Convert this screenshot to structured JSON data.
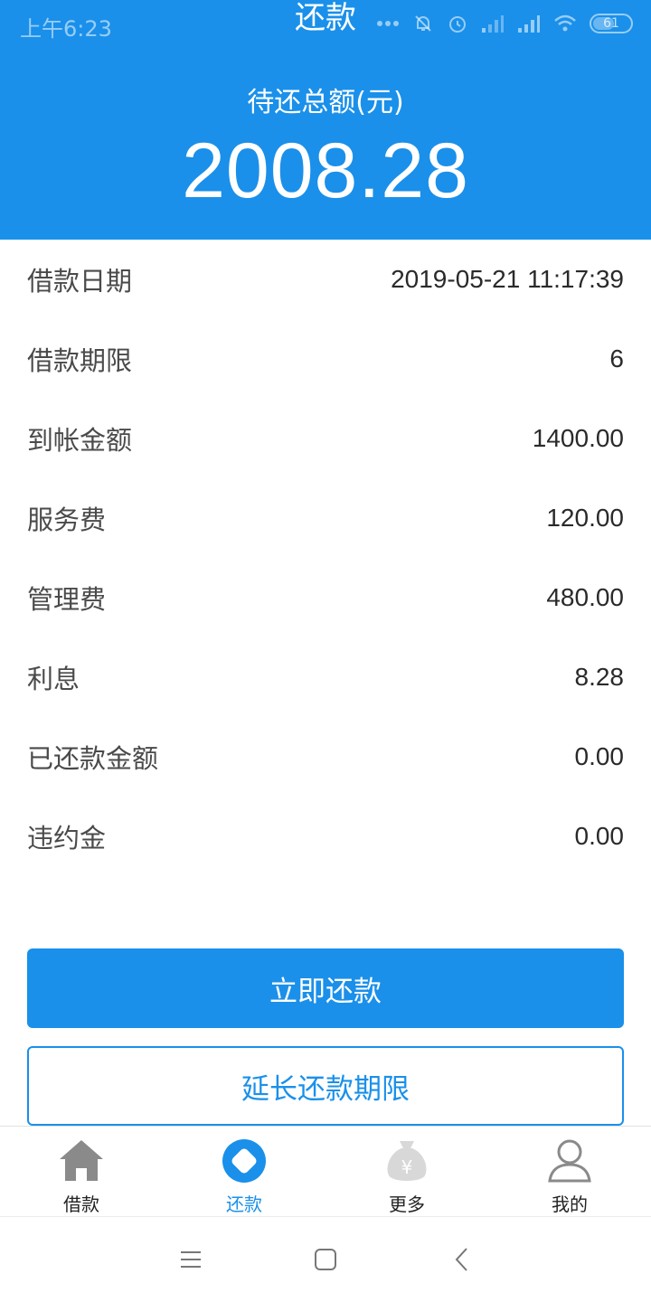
{
  "status_bar": {
    "time": "上午6:23",
    "battery": "61",
    "battery_level": 0.61
  },
  "header": {
    "title": "还款",
    "total_label": "待还总额(元)",
    "total_amount": "2008.28"
  },
  "details": [
    {
      "label": "借款日期",
      "value": "2019-05-21 11:17:39"
    },
    {
      "label": "借款期限",
      "value": "6"
    },
    {
      "label": "到帐金额",
      "value": "1400.00"
    },
    {
      "label": "服务费",
      "value": "120.00"
    },
    {
      "label": "管理费",
      "value": "480.00"
    },
    {
      "label": "利息",
      "value": "8.28"
    },
    {
      "label": "已还款金额",
      "value": "0.00"
    },
    {
      "label": "违约金",
      "value": "0.00"
    }
  ],
  "actions": {
    "pay_now": "立即还款",
    "extend": "延长还款期限"
  },
  "tabs": [
    {
      "label": "借款",
      "icon": "home-icon"
    },
    {
      "label": "还款",
      "icon": "repay-diamond-icon",
      "active": true
    },
    {
      "label": "更多",
      "icon": "money-bag-icon"
    },
    {
      "label": "我的",
      "icon": "user-icon"
    }
  ],
  "colors": {
    "primary": "#1a90ea",
    "tab_inactive_icon": "#8a8a8a"
  }
}
